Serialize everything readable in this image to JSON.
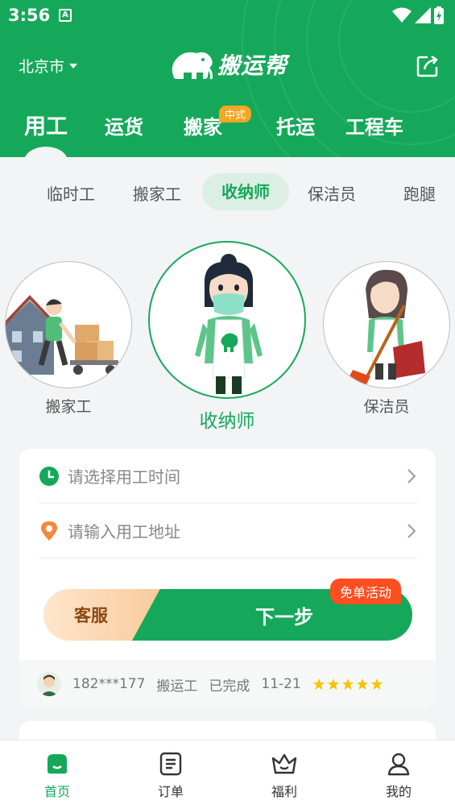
{
  "status_bar": {
    "time": "3:56",
    "notification": "A"
  },
  "header": {
    "city": "北京市",
    "brand": "搬运帮",
    "tabs": [
      {
        "label": "用工",
        "active": true
      },
      {
        "label": "运货"
      },
      {
        "label": "搬家",
        "badge": "中式"
      },
      {
        "label": "托运"
      },
      {
        "label": "工程车"
      }
    ]
  },
  "sub_tabs": [
    "临时工",
    "搬家工",
    "收纳师",
    "保洁员",
    "跑腿"
  ],
  "sub_tab_active": "收纳师",
  "roles": {
    "left": "搬家工",
    "center": "收纳师",
    "right": "保洁员"
  },
  "form": {
    "time_placeholder": "请选择用工时间",
    "address_placeholder": "请输入用工地址",
    "service_label": "客服",
    "next_label": "下一步",
    "promo": "免单活动"
  },
  "ticker": {
    "phone": "182***177",
    "role": "搬运工",
    "status": "已完成",
    "date": "11-21",
    "stars": 5
  },
  "bottom_nav": [
    {
      "label": "首页",
      "icon": "home-icon",
      "active": true
    },
    {
      "label": "订单",
      "icon": "order-icon"
    },
    {
      "label": "福利",
      "icon": "crown-icon"
    },
    {
      "label": "我的",
      "icon": "user-icon"
    }
  ],
  "colors": {
    "brand_green": "#16a85a",
    "promo_red": "#ff4e1f",
    "badge_orange": "#f5a623",
    "star_yellow": "#f5c400"
  }
}
